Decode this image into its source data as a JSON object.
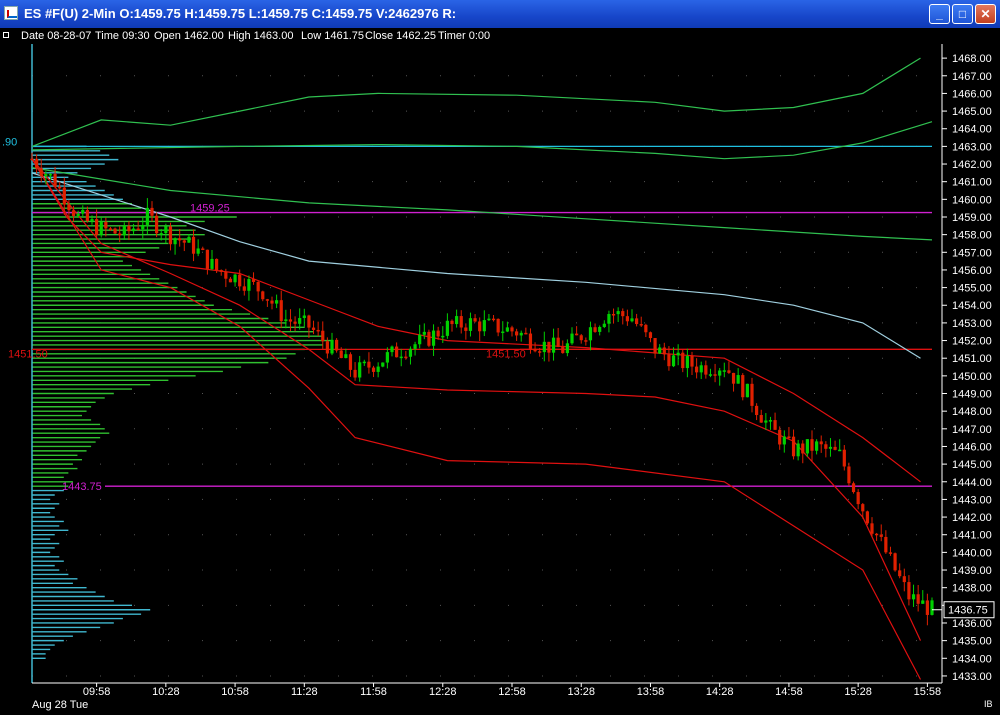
{
  "window": {
    "title": "ES #F(U)  2-Min  O:1459.75  H:1459.75  L:1459.75  C:1459.75  V:2462976  R:",
    "buttons": {
      "minimize": "_",
      "maximize": "□",
      "close": "✕"
    }
  },
  "infobar": {
    "date": "Date 08-28-07",
    "time": "Time 09:30",
    "open": "Open 1462.00",
    "high": "High 1463.00",
    "low": "Low 1461.75",
    "close": "Close 1462.25",
    "timer": "Timer 0:00"
  },
  "corner_label": "IB",
  "colors": {
    "background": "#000000",
    "up_bar": "#00d000",
    "down_bar": "#e02000",
    "profile_green": "#30c030",
    "profile_cyan": "#40b8d0",
    "band_red": "#e01010",
    "band_green": "#30c050",
    "vwap": "#a0d0e0",
    "level_magenta": "#d020d0",
    "level_red": "#e01010",
    "level_cyan": "#20c0e0",
    "axis_text": "#ffffff"
  },
  "chart_data": {
    "type": "line",
    "title": "",
    "xlabel": "",
    "ylabel": "",
    "ylim": [
      1432.6,
      1468.8
    ],
    "xlim": [
      "09:30",
      "16:00"
    ],
    "x_ticks": [
      "09:58",
      "10:28",
      "10:58",
      "11:28",
      "11:58",
      "12:28",
      "12:58",
      "13:28",
      "13:58",
      "14:28",
      "14:58",
      "15:28",
      "15:58"
    ],
    "date_label": "Aug 28 Tue",
    "y_ticks": [
      1433,
      1434,
      1435,
      1436,
      1437,
      1438,
      1439,
      1440,
      1441,
      1442,
      1443,
      1444,
      1445,
      1446,
      1447,
      1448,
      1449,
      1450,
      1451,
      1452,
      1453,
      1454,
      1455,
      1456,
      1457,
      1458,
      1459,
      1460,
      1461,
      1462,
      1463,
      1464,
      1465,
      1466,
      1467,
      1468
    ],
    "last_price": "1436.75",
    "horizontal_levels": [
      {
        "price": 1463.0,
        "label": ".90",
        "color": "#20c0e0"
      },
      {
        "price": 1459.25,
        "label": "1459.25",
        "color": "#d020d0"
      },
      {
        "price": 1451.5,
        "label": "1451.50",
        "color": "#e01010"
      },
      {
        "price": 1451.5,
        "label": "1451.50",
        "color": "#e01010"
      },
      {
        "price": 1443.75,
        "label": "1443.75",
        "color": "#d020d0"
      }
    ],
    "close_series": [
      [
        "09:30",
        1462.3
      ],
      [
        "09:40",
        1461.0
      ],
      [
        "09:50",
        1459.0
      ],
      [
        "10:00",
        1458.3
      ],
      [
        "10:10",
        1458.0
      ],
      [
        "10:20",
        1459.0
      ],
      [
        "10:30",
        1458.0
      ],
      [
        "10:40",
        1457.3
      ],
      [
        "10:50",
        1456.0
      ],
      [
        "11:00",
        1455.5
      ],
      [
        "11:10",
        1454.8
      ],
      [
        "11:20",
        1453.2
      ],
      [
        "11:30",
        1452.8
      ],
      [
        "11:40",
        1451.5
      ],
      [
        "11:50",
        1450.2
      ],
      [
        "12:00",
        1450.8
      ],
      [
        "12:10",
        1451.5
      ],
      [
        "12:20",
        1452.0
      ],
      [
        "12:30",
        1452.8
      ],
      [
        "12:40",
        1453.0
      ],
      [
        "12:50",
        1452.8
      ],
      [
        "13:00",
        1452.5
      ],
      [
        "13:10",
        1451.8
      ],
      [
        "13:20",
        1451.5
      ],
      [
        "13:30",
        1452.5
      ],
      [
        "13:40",
        1453.6
      ],
      [
        "13:50",
        1453.3
      ],
      [
        "14:00",
        1451.5
      ],
      [
        "14:10",
        1450.8
      ],
      [
        "14:20",
        1450.5
      ],
      [
        "14:30",
        1450.6
      ],
      [
        "14:40",
        1449.0
      ],
      [
        "14:50",
        1447.0
      ],
      [
        "15:00",
        1445.8
      ],
      [
        "15:10",
        1446.0
      ],
      [
        "15:20",
        1445.5
      ],
      [
        "15:30",
        1442.5
      ],
      [
        "15:40",
        1440.0
      ],
      [
        "15:50",
        1437.5
      ],
      [
        "16:00",
        1436.75
      ]
    ],
    "series": [
      {
        "color": "#30c050",
        "points": [
          [
            "09:30",
            1463.0
          ],
          [
            "10:00",
            1464.5
          ],
          [
            "10:30",
            1464.2
          ],
          [
            "11:00",
            1465.0
          ],
          [
            "11:30",
            1465.8
          ],
          [
            "12:00",
            1466.0
          ],
          [
            "13:00",
            1465.9
          ],
          [
            "14:00",
            1465.5
          ],
          [
            "14:30",
            1465.0
          ],
          [
            "15:00",
            1465.2
          ],
          [
            "15:30",
            1466.0
          ],
          [
            "15:55",
            1468.0
          ]
        ]
      },
      {
        "color": "#30c050",
        "points": [
          [
            "09:30",
            1462.8
          ],
          [
            "11:00",
            1463.0
          ],
          [
            "12:00",
            1463.1
          ],
          [
            "13:00",
            1463.0
          ],
          [
            "14:00",
            1462.6
          ],
          [
            "14:30",
            1462.3
          ],
          [
            "15:00",
            1462.5
          ],
          [
            "15:30",
            1463.2
          ],
          [
            "16:00",
            1464.4
          ]
        ]
      },
      {
        "color": "#30c050",
        "points": [
          [
            "09:30",
            1461.8
          ],
          [
            "10:30",
            1460.5
          ],
          [
            "11:30",
            1459.8
          ],
          [
            "12:30",
            1459.4
          ],
          [
            "13:30",
            1458.9
          ],
          [
            "14:30",
            1458.4
          ],
          [
            "15:30",
            1457.9
          ],
          [
            "16:00",
            1457.7
          ]
        ]
      },
      {
        "color": "#a0d0e0",
        "points": [
          [
            "09:30",
            1461.5
          ],
          [
            "10:30",
            1459.0
          ],
          [
            "11:00",
            1457.6
          ],
          [
            "11:30",
            1456.5
          ],
          [
            "12:30",
            1455.8
          ],
          [
            "13:30",
            1455.3
          ],
          [
            "14:30",
            1454.6
          ],
          [
            "15:00",
            1454.0
          ],
          [
            "15:30",
            1453.0
          ],
          [
            "15:55",
            1451.0
          ]
        ]
      },
      {
        "color": "#e01010",
        "points": [
          [
            "09:30",
            1462.3
          ],
          [
            "09:45",
            1459.0
          ],
          [
            "10:00",
            1457.0
          ],
          [
            "10:30",
            1456.3
          ],
          [
            "11:00",
            1455.8
          ],
          [
            "11:30",
            1454.3
          ],
          [
            "12:00",
            1452.8
          ],
          [
            "12:30",
            1452.0
          ],
          [
            "13:30",
            1451.6
          ],
          [
            "14:30",
            1451.0
          ],
          [
            "15:00",
            1449.0
          ],
          [
            "15:30",
            1446.5
          ],
          [
            "15:55",
            1444.0
          ]
        ]
      },
      {
        "color": "#e01010",
        "points": [
          [
            "09:30",
            1462.3
          ],
          [
            "10:00",
            1457.5
          ],
          [
            "10:30",
            1455.8
          ],
          [
            "11:00",
            1454.0
          ],
          [
            "11:30",
            1451.5
          ],
          [
            "11:50",
            1449.5
          ],
          [
            "12:30",
            1449.2
          ],
          [
            "13:30",
            1449.0
          ],
          [
            "14:00",
            1448.8
          ],
          [
            "14:30",
            1448.0
          ],
          [
            "15:00",
            1446.3
          ],
          [
            "15:30",
            1442.0
          ],
          [
            "15:55",
            1435.0
          ]
        ]
      },
      {
        "color": "#e01010",
        "points": [
          [
            "09:30",
            1462.3
          ],
          [
            "10:00",
            1456.0
          ],
          [
            "10:30",
            1455.0
          ],
          [
            "11:00",
            1452.8
          ],
          [
            "11:30",
            1449.3
          ],
          [
            "11:50",
            1446.5
          ],
          [
            "12:30",
            1445.2
          ],
          [
            "13:30",
            1445.0
          ],
          [
            "14:30",
            1444.0
          ],
          [
            "15:00",
            1441.5
          ],
          [
            "15:30",
            1439.0
          ],
          [
            "15:55",
            1432.8
          ]
        ]
      }
    ],
    "profile": [
      [
        1463.0,
        12
      ],
      [
        1462.75,
        15
      ],
      [
        1462.5,
        17
      ],
      [
        1462.25,
        19
      ],
      [
        1462.0,
        16
      ],
      [
        1461.75,
        13
      ],
      [
        1461.5,
        10
      ],
      [
        1461.25,
        8
      ],
      [
        1461.0,
        12
      ],
      [
        1460.75,
        14
      ],
      [
        1460.5,
        16
      ],
      [
        1460.25,
        18
      ],
      [
        1460.0,
        20
      ],
      [
        1459.75,
        22
      ],
      [
        1459.5,
        24
      ],
      [
        1459.25,
        32
      ],
      [
        1459.0,
        45
      ],
      [
        1458.75,
        38
      ],
      [
        1458.5,
        34
      ],
      [
        1458.25,
        36
      ],
      [
        1458.0,
        38
      ],
      [
        1457.75,
        35
      ],
      [
        1457.5,
        30
      ],
      [
        1457.25,
        28
      ],
      [
        1457.0,
        25
      ],
      [
        1456.75,
        22
      ],
      [
        1456.5,
        20
      ],
      [
        1456.25,
        22
      ],
      [
        1456.0,
        24
      ],
      [
        1455.75,
        26
      ],
      [
        1455.5,
        28
      ],
      [
        1455.25,
        30
      ],
      [
        1455.0,
        32
      ],
      [
        1454.75,
        34
      ],
      [
        1454.5,
        36
      ],
      [
        1454.25,
        38
      ],
      [
        1454.0,
        40
      ],
      [
        1453.75,
        44
      ],
      [
        1453.5,
        48
      ],
      [
        1453.25,
        52
      ],
      [
        1453.0,
        56
      ],
      [
        1452.75,
        60
      ],
      [
        1452.5,
        62
      ],
      [
        1452.25,
        64
      ],
      [
        1452.0,
        66
      ],
      [
        1451.75,
        64
      ],
      [
        1451.5,
        60
      ],
      [
        1451.25,
        58
      ],
      [
        1451.0,
        56
      ],
      [
        1450.75,
        52
      ],
      [
        1450.5,
        46
      ],
      [
        1450.25,
        42
      ],
      [
        1450.0,
        36
      ],
      [
        1449.75,
        30
      ],
      [
        1449.5,
        26
      ],
      [
        1449.25,
        22
      ],
      [
        1449.0,
        18
      ],
      [
        1448.75,
        16
      ],
      [
        1448.5,
        14
      ],
      [
        1448.25,
        13
      ],
      [
        1448.0,
        12
      ],
      [
        1447.75,
        11
      ],
      [
        1447.5,
        13
      ],
      [
        1447.25,
        15
      ],
      [
        1447.0,
        16
      ],
      [
        1446.75,
        17
      ],
      [
        1446.5,
        15
      ],
      [
        1446.25,
        14
      ],
      [
        1446.0,
        13
      ],
      [
        1445.75,
        12
      ],
      [
        1445.5,
        10
      ],
      [
        1445.25,
        11
      ],
      [
        1445.0,
        9
      ],
      [
        1444.75,
        10
      ],
      [
        1444.5,
        8
      ],
      [
        1444.25,
        7
      ],
      [
        1444.0,
        9
      ],
      [
        1443.75,
        8
      ],
      [
        1443.5,
        7
      ],
      [
        1443.25,
        5
      ],
      [
        1443.0,
        4
      ],
      [
        1442.75,
        6
      ],
      [
        1442.5,
        5
      ],
      [
        1442.25,
        4
      ],
      [
        1442.0,
        5
      ],
      [
        1441.75,
        7
      ],
      [
        1441.5,
        6
      ],
      [
        1441.25,
        8
      ],
      [
        1441.0,
        5
      ],
      [
        1440.75,
        4
      ],
      [
        1440.5,
        6
      ],
      [
        1440.25,
        5
      ],
      [
        1440.0,
        4
      ],
      [
        1439.75,
        6
      ],
      [
        1439.5,
        7
      ],
      [
        1439.25,
        5
      ],
      [
        1439.0,
        6
      ],
      [
        1438.75,
        8
      ],
      [
        1438.5,
        10
      ],
      [
        1438.25,
        9
      ],
      [
        1438.0,
        12
      ],
      [
        1437.75,
        14
      ],
      [
        1437.5,
        16
      ],
      [
        1437.25,
        18
      ],
      [
        1437.0,
        22
      ],
      [
        1436.75,
        26
      ],
      [
        1436.5,
        24
      ],
      [
        1436.25,
        20
      ],
      [
        1436.0,
        18
      ],
      [
        1435.75,
        15
      ],
      [
        1435.5,
        12
      ],
      [
        1435.25,
        9
      ],
      [
        1435.0,
        7
      ],
      [
        1434.75,
        5
      ],
      [
        1434.5,
        4
      ],
      [
        1434.25,
        3
      ],
      [
        1434.0,
        3
      ]
    ]
  }
}
